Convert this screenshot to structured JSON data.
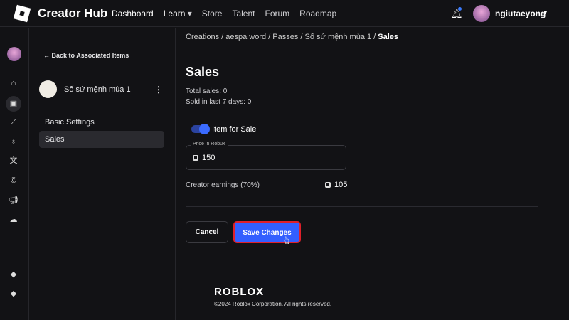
{
  "header": {
    "brand": "Creator Hub",
    "nav": [
      "Dashboard",
      "Learn",
      "Store",
      "Talent",
      "Forum",
      "Roadmap"
    ],
    "username": "ngiutaeyong"
  },
  "rail": [
    "home-icon",
    "creations-icon",
    "analytics-icon",
    "monetization-icon",
    "translate-icon",
    "copyright-icon",
    "ads-icon",
    "cloud-icon"
  ],
  "sidebar": {
    "back": "Back to Associated Items",
    "item_name": "Số sứ mệnh mùa 1",
    "menu": [
      "Basic Settings",
      "Sales"
    ]
  },
  "breadcrumb": [
    "Creations",
    "aespa word",
    "Passes",
    "Số sứ mệnh mùa 1",
    "Sales"
  ],
  "main": {
    "title": "Sales",
    "total_sales": "Total sales: 0",
    "sold_7d": "Sold in last 7 days: 0",
    "toggle_label": "Item for Sale",
    "toggle_on": true,
    "price_label": "Price in Robux",
    "price": "150",
    "earnings_label": "Creator earnings (70%)",
    "earnings": "105",
    "cancel": "Cancel",
    "save": "Save Changes"
  },
  "footer": {
    "logo": "ROBLOX",
    "copyright": "©2024 Roblox Corporation. All rights reserved."
  }
}
